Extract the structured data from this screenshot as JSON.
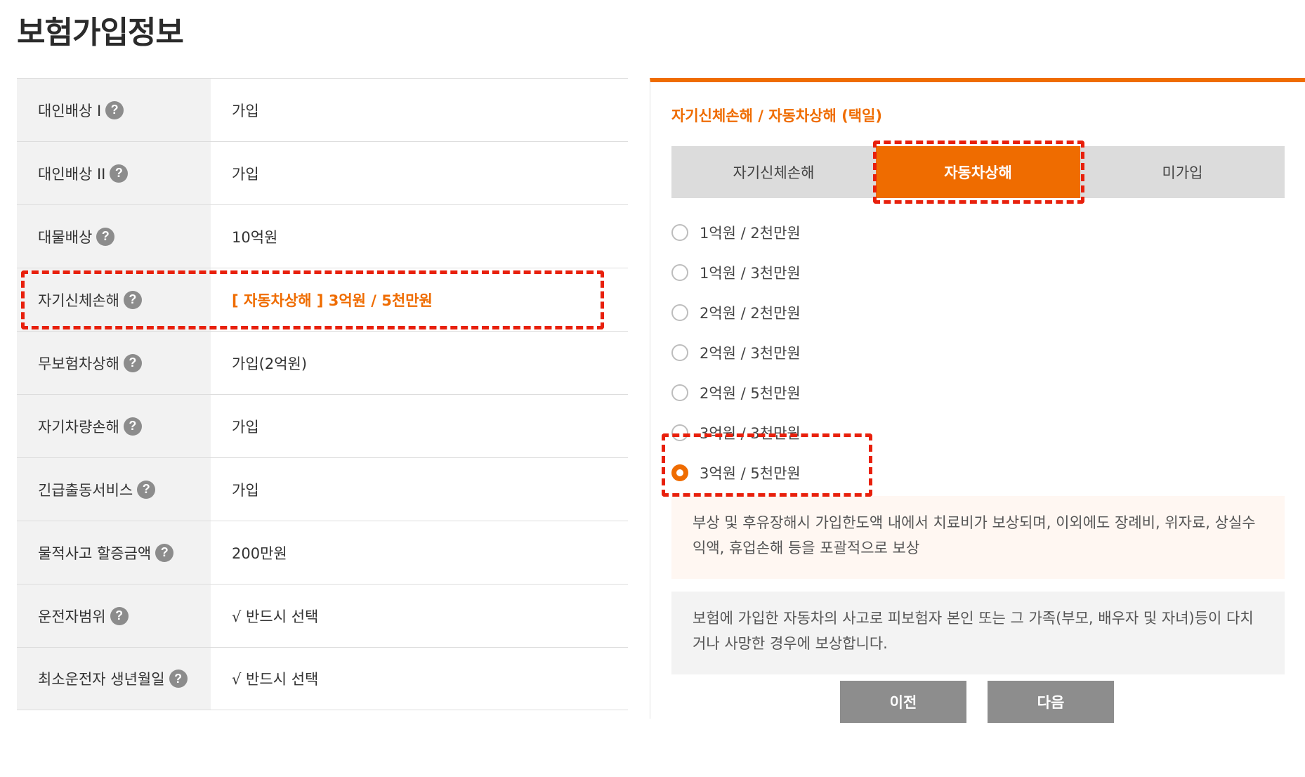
{
  "page": {
    "title": "보험가입정보"
  },
  "info_rows": [
    {
      "label": "대인배상 I",
      "value": "가입"
    },
    {
      "label": "대인배상 II",
      "value": "가입"
    },
    {
      "label": "대물배상",
      "value": "10억원"
    },
    {
      "label": "자기신체손해",
      "value": "[   자동차상해   ] 3억원 / 5천만원",
      "highlight": true
    },
    {
      "label": "무보험차상해",
      "value": "가입(2억원)"
    },
    {
      "label": "자기차량손해",
      "value": "가입"
    },
    {
      "label": "긴급출동서비스",
      "value": "가입"
    },
    {
      "label": "물적사고 할증금액",
      "value": "200만원"
    },
    {
      "label": "운전자범위",
      "value": "√ 반드시 선택"
    },
    {
      "label": "최소운전자 생년월일",
      "value": "√ 반드시 선택"
    }
  ],
  "help_icon": "?",
  "panel": {
    "title": "자기신체손해 / 자동차상해 (택일)",
    "tabs": [
      {
        "label": "자기신체손해",
        "active": false
      },
      {
        "label": "자동차상해",
        "active": true
      },
      {
        "label": "미가입",
        "active": false
      }
    ],
    "options": [
      {
        "label": "1억원 / 2천만원",
        "checked": false
      },
      {
        "label": "1억원 / 3천만원",
        "checked": false
      },
      {
        "label": "2억원 / 2천만원",
        "checked": false
      },
      {
        "label": "2억원 / 3천만원",
        "checked": false
      },
      {
        "label": "2억원 / 5천만원",
        "checked": false
      },
      {
        "label": "3억원 / 3천만원",
        "checked": false
      },
      {
        "label": "3억원 / 5천만원",
        "checked": true
      }
    ],
    "desc_primary": "부상 및 후유장해시 가입한도액 내에서 치료비가 보상되며, 이외에도 장례비, 위자료, 상실수익액, 휴업손해 등을 포괄적으로 보상",
    "desc_secondary": "보험에 가입한 자동차의 사고로 피보험자 본인 또는 그 가족(부모, 배우자 및 자녀)등이 다치거나 사망한 경우에 보상합니다.",
    "prev_label": "이전",
    "next_label": "다음"
  },
  "colors": {
    "accent": "#ef6c00",
    "highlight_box": "#e8200c",
    "button_gray": "#8d8d8d"
  }
}
